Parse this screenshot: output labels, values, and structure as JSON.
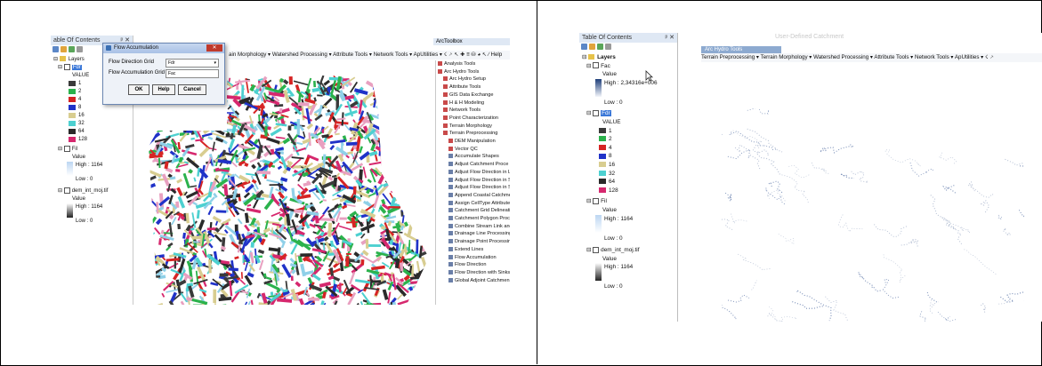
{
  "left_screenshot": {
    "toc": {
      "title": "able Of Contents",
      "pin": "ᵖ ✕",
      "layers_label": "Layers",
      "fdr_layer": "Fdr",
      "value_label": "VALUE",
      "fdr_values": [
        "1",
        "2",
        "4",
        "8",
        "16",
        "32",
        "64",
        "128"
      ],
      "fdr_colors": [
        "#3a3a3a",
        "#2bb24c",
        "#d62424",
        "#2032c8",
        "#d8cd90",
        "#4dd0d0",
        "#2a2a2a",
        "#d6286e"
      ],
      "fil_layer": "Fil",
      "fil_value": "Value",
      "fil_high": "High : 1164",
      "fil_low": "Low : 0",
      "dem_layer": "dem_int_moj.tif",
      "dem_value": "Value",
      "dem_high": "High : 1164",
      "dem_low": "Low : 0"
    },
    "dialog": {
      "title": "Flow Accumulation",
      "close": "✕",
      "fdg_label": "Flow Direction Grid",
      "fdg_value": "Fdr",
      "fag_label": "Flow Accumulation Grid",
      "fag_value": "Fac",
      "ok": "OK",
      "help": "Help",
      "cancel": "Cancel"
    },
    "menubar": "ain Morphology ▾  Watershed Processing ▾  Attribute Tools ▾  Network Tools ▾  ApUtilities ▾  ☇  ⸕  ↖  ✚  ≡  ⛁  ◕  ↖  ∕  Help",
    "toolbox_title": "ArcToolbox",
    "toolbox_items": [
      "Analysis Tools",
      "Arc Hydro Tools",
      "Arc Hydro Setup",
      "Attribute Tools",
      "GIS Data Exchange",
      "H & H Modeling",
      "Network Tools",
      "Point Characterization",
      "Terrain Morphology",
      "Terrain Preprocessing",
      "DEM Manipulation",
      "Vector QC",
      "Accumulate Shapes",
      "Adjust Catchment Proce",
      "Adjust Flow Direction in L",
      "Adjust Flow Direction in S",
      "Adjust Flow Direction in S",
      "Append Coastal Catchme",
      "Assign CellType Attribute",
      "Catchment Grid Delineati",
      "Catchment Polygon Proc",
      "Combine Stream Link and",
      "Drainage Line Processing",
      "Drainage Point Processing",
      "Extend Lines",
      "Flow Accumulation",
      "Flow Direction",
      "Flow Direction with Sinks",
      "Global Adjoint Catchmen"
    ]
  },
  "right_screenshot": {
    "faded_caption": "User-Defined Catchment",
    "toc": {
      "title": "Table Of Contents",
      "pin": "ᵖ ✕",
      "layers_label": "Layers",
      "fac_layer": "Fac",
      "fac_value": "Value",
      "fac_high": "High : 2,34316e+006",
      "fac_low": "Low : 0",
      "fdr_layer": "Fdr",
      "value_label": "VALUE",
      "fdr_values": [
        "1",
        "2",
        "4",
        "8",
        "16",
        "32",
        "64",
        "128"
      ],
      "fil_layer": "Fil",
      "fil_value": "Value",
      "fil_high": "High : 1164",
      "fil_low": "Low : 0",
      "dem_layer": "dem_int_moj.tif",
      "dem_value": "Value",
      "dem_high": "High : 1164",
      "dem_low": "Low : 0"
    },
    "arc_hydro_title": "Arc Hydro Tools",
    "menubar": "Terrain Preprocessing ▾  Terrain Morphology ▾  Watershed Processing ▾  Attribute Tools ▾  Network Tools ▾  ApUtilities ▾  ☇  ⸕"
  }
}
